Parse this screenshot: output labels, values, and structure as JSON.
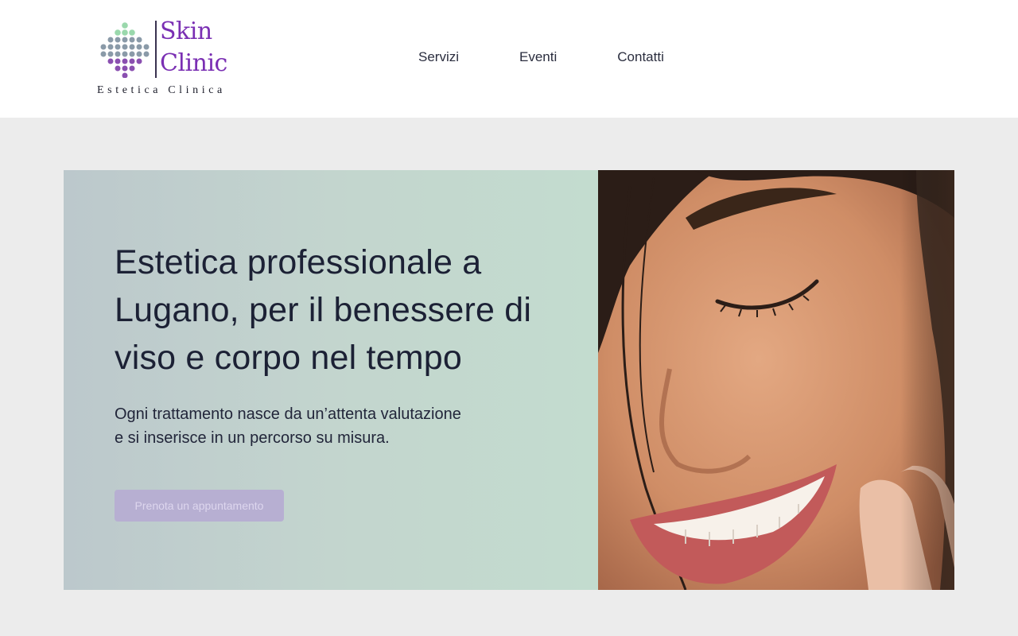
{
  "logo": {
    "word_top": "Skin",
    "word_bottom": "Clinic",
    "tagline": "Estetica Clinica",
    "accent_color": "#7a2fb3",
    "dot_colors": [
      "#9ad8ac",
      "#8a9aa8",
      "#8a4fb0"
    ]
  },
  "nav": {
    "items": [
      {
        "label": "Servizi"
      },
      {
        "label": "Eventi"
      },
      {
        "label": "Contatti"
      }
    ]
  },
  "hero": {
    "title": "Estetica professionale a Lugano, per il benessere di viso e corpo nel tempo",
    "subtitle_line1": "Ogni trattamento nasce da un’attenta valutazione",
    "subtitle_line2": "e si inserisce in un percorso su misura.",
    "cta_label": "Prenota un appuntamento",
    "image_alt": "smiling-woman-portrait",
    "colors": {
      "panel_start": "#bcc8cc",
      "panel_end": "#c3dccf",
      "cta_bg": "#b7afd2"
    }
  }
}
